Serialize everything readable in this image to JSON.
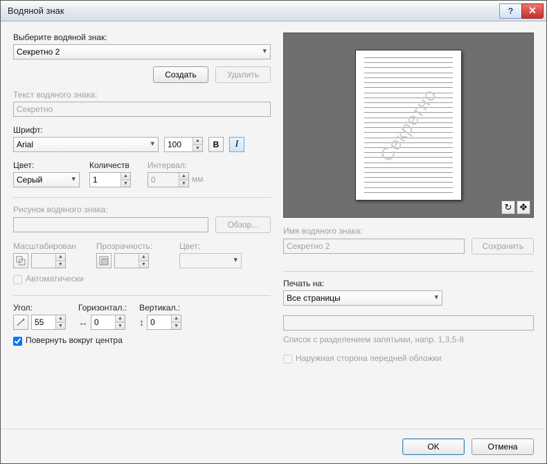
{
  "title": "Водяной знак",
  "select_label": "Выберите водяной знак:",
  "selected_watermark": "Секретно 2",
  "create_btn": "Создать",
  "delete_btn": "Удалить",
  "text_label": "Текст водяного знака:",
  "text_value": "Секретно",
  "font_label": "Шрифт:",
  "font_value": "Arial",
  "font_size": "100",
  "color_label": "Цвет:",
  "color_value": "Серый",
  "count_label": "Количеств",
  "count_value": "1",
  "interval_label": "Интервал:",
  "interval_value": "0",
  "interval_unit": "мм",
  "picture_label": "Рисунок водяного знака:",
  "browse_btn": "Обзор...",
  "scale_label": "Масштабирован",
  "transparency_label": "Прозрачность:",
  "color2_label": "Цвет:",
  "auto_label": "Автоматически",
  "angle_label": "Угол:",
  "angle_value": "55",
  "horiz_label": "Горизонтал.:",
  "horiz_value": "0",
  "vert_label": "Вертикал.:",
  "vert_value": "0",
  "rotate_center_label": "Повернуть вокруг центра",
  "name_label": "Имя водяного знака:",
  "name_value": "Секретно 2",
  "save_btn": "Сохранить",
  "print_on_label": "Печать на:",
  "print_on_value": "Все страницы",
  "pages_hint": "Список с разделением запятыми, напр. 1,3,5-8",
  "front_cover_label": "Наружная сторона передней обложки",
  "ok_btn": "OK",
  "cancel_btn": "Отмена",
  "preview_text": "Секретно"
}
